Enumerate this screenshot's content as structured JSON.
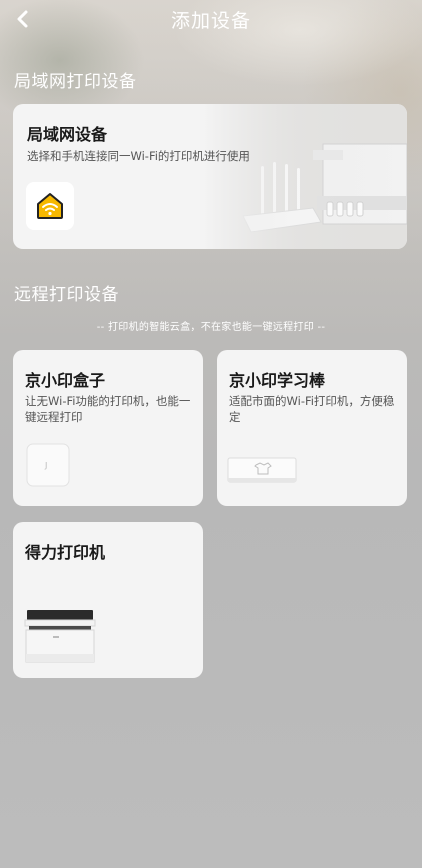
{
  "header": {
    "title": "添加设备",
    "back_icon": "chevron-left-icon"
  },
  "lan_section": {
    "title": "局域网打印设备",
    "card": {
      "title": "局域网设备",
      "desc": "选择和手机连接同一Wi-Fi的打印机进行使用",
      "icon": "wifi-home-icon",
      "icon_color": "#f6b800"
    }
  },
  "remote_section": {
    "title": "远程打印设备",
    "tagline": "-- 打印机的智能云盒，不在家也能一键远程打印 --",
    "cards": [
      {
        "title": "京小印盒子",
        "desc": "让无Wi-Fi功能的打印机，也能一键远程打印",
        "image": "print-box-image"
      },
      {
        "title": "京小印学习棒",
        "desc": "适配市面的Wi-Fi打印机，方便稳定",
        "image": "print-stick-image"
      },
      {
        "title": "得力打印机",
        "desc": "",
        "image": "printer-image"
      }
    ]
  },
  "colors": {
    "card_bg": "#f4f4f4",
    "text_primary": "#1a1a1a",
    "text_secondary": "#555555"
  }
}
